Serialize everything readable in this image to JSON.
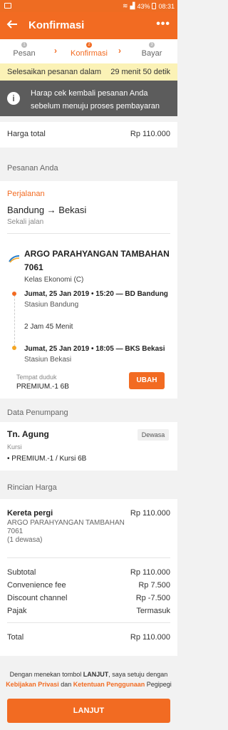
{
  "status_bar": {
    "battery": "43%",
    "time": "08:31"
  },
  "app_bar": {
    "back_icon": "arrow-left-icon",
    "title": "Konfirmasi",
    "more_icon": "more-dots-icon",
    "more_glyph": "•••"
  },
  "stepper": {
    "steps": [
      {
        "label": "Pesan",
        "number": "1"
      },
      {
        "label": "Konfirmasi",
        "number": "2"
      },
      {
        "label": "Bayar",
        "number": "3"
      }
    ],
    "active_index": 1
  },
  "timer": {
    "label": "Selesaikan pesanan dalam",
    "value": "29 menit 50 detik"
  },
  "notice": {
    "line1": "Harap cek kembali pesanan Anda",
    "line2": "sebelum menuju proses pembayaran"
  },
  "total_top": {
    "label": "Harga total",
    "value": "Rp 110.000"
  },
  "order": {
    "section_title": "Pesanan Anda",
    "trip_label": "Perjalanan",
    "route": "Bandung → Bekasi",
    "trip_type": "Sekali jalan",
    "train_name_line1": "ARGO PARAHYANGAN TAMBAHAN",
    "train_name_line2": "7061",
    "train_class": "Kelas Ekonomi (C)",
    "departure": "Jumat, 25 Jan 2019 • 15:20 — BD Bandung",
    "departure_station": "Stasiun Bandung",
    "duration": "2 Jam 45 Menit",
    "arrival": "Jumat, 25 Jan 2019 • 18:05 — BKS Bekasi",
    "arrival_station": "Stasiun Bekasi",
    "seat_label": "Tempat duduk",
    "seat_value": "PREMIUM.-1 6B",
    "change_button": "UBAH"
  },
  "passenger": {
    "section_title": "Data Penumpang",
    "name": "Tn. Agung",
    "type_badge": "Dewasa",
    "seat_label": "Kursi",
    "seat_value": "• PREMIUM.-1 / Kursi 6B"
  },
  "price": {
    "section_title": "Rincian Harga",
    "item_label": "Kereta pergi",
    "item_desc1": "ARGO PARAHYANGAN TAMBAHAN",
    "item_desc2": "7061",
    "item_desc3": "(1 dewasa)",
    "item_value": "Rp 110.000",
    "subtotal_label": "Subtotal",
    "subtotal_value": "Rp 110.000",
    "fee_label": "Convenience fee",
    "fee_value": "Rp 7.500",
    "discount_label": "Discount channel",
    "discount_value": "Rp -7.500",
    "tax_label": "Pajak",
    "tax_value": "Termasuk",
    "total_label": "Total",
    "total_value": "Rp 110.000"
  },
  "terms": {
    "prefix": "Dengan menekan tombol ",
    "button_ref": "LANJUT",
    "middle": ", saya setuju dengan",
    "privacy_link": "Kebijakan Privasi",
    "and": " dan ",
    "terms_link": "Ketentuan Penggunaan",
    "suffix": " Pegipegi"
  },
  "continue_button": "LANJUT",
  "colors": {
    "accent": "#f26b22",
    "timer_bg": "#fbf2b6",
    "notice_bg": "#5c5c5c"
  }
}
